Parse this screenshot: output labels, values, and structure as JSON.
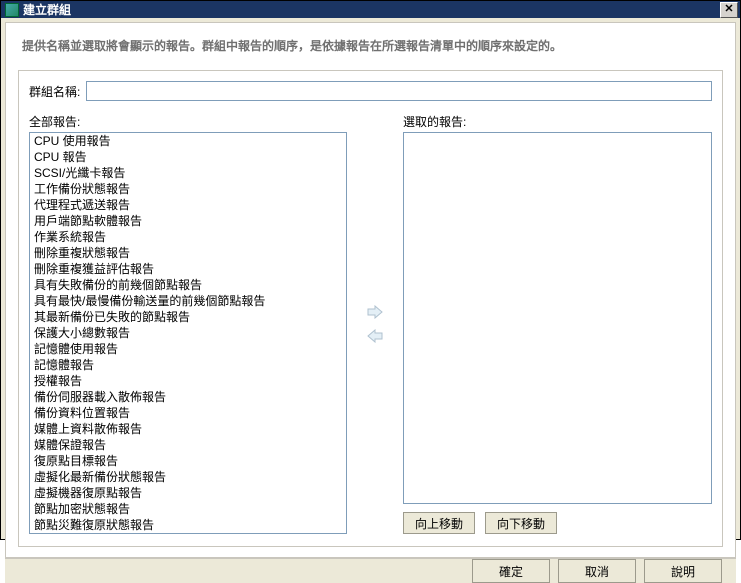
{
  "window": {
    "title": "建立群組"
  },
  "subtitle": "提供名稱並選取將會顯示的報告。群組中報告的順序，是依據報告在所選報告清單中的順序來設定的。",
  "group_name": {
    "label": "群組名稱:",
    "value": ""
  },
  "all_reports": {
    "label": "全部報告:",
    "items": [
      "CPU 使用報告",
      "CPU 報告",
      "SCSI/光纖卡報告",
      "工作備份狀態報告",
      "代理程式遞送報告",
      "用戶端節點軟體報告",
      "作業系統報告",
      "刪除重複狀態報告",
      "刪除重複獲益評估報告",
      "具有失敗備份的前幾個節點報告",
      "具有最快/最慢備份輸送量的前幾個節點報告",
      "其最新備份已失敗的節點報告",
      "保護大小總數報告",
      "記憶體使用報告",
      "記憶體報告",
      "授權報告",
      "備份伺服器載入散佈報告",
      "備份資料位置報告",
      "媒體上資料散佈報告",
      "媒體保證報告",
      "復原點目標報告",
      "虛擬化最新備份狀態報告",
      "虛擬機器復原點報告",
      "節點加密狀態報告",
      "節點災難復原狀態報告"
    ]
  },
  "selected_reports": {
    "label": "選取的報告:",
    "items": []
  },
  "buttons": {
    "move_up": "向上移動",
    "move_down": "向下移動",
    "ok": "確定",
    "cancel": "取消",
    "help": "說明"
  }
}
